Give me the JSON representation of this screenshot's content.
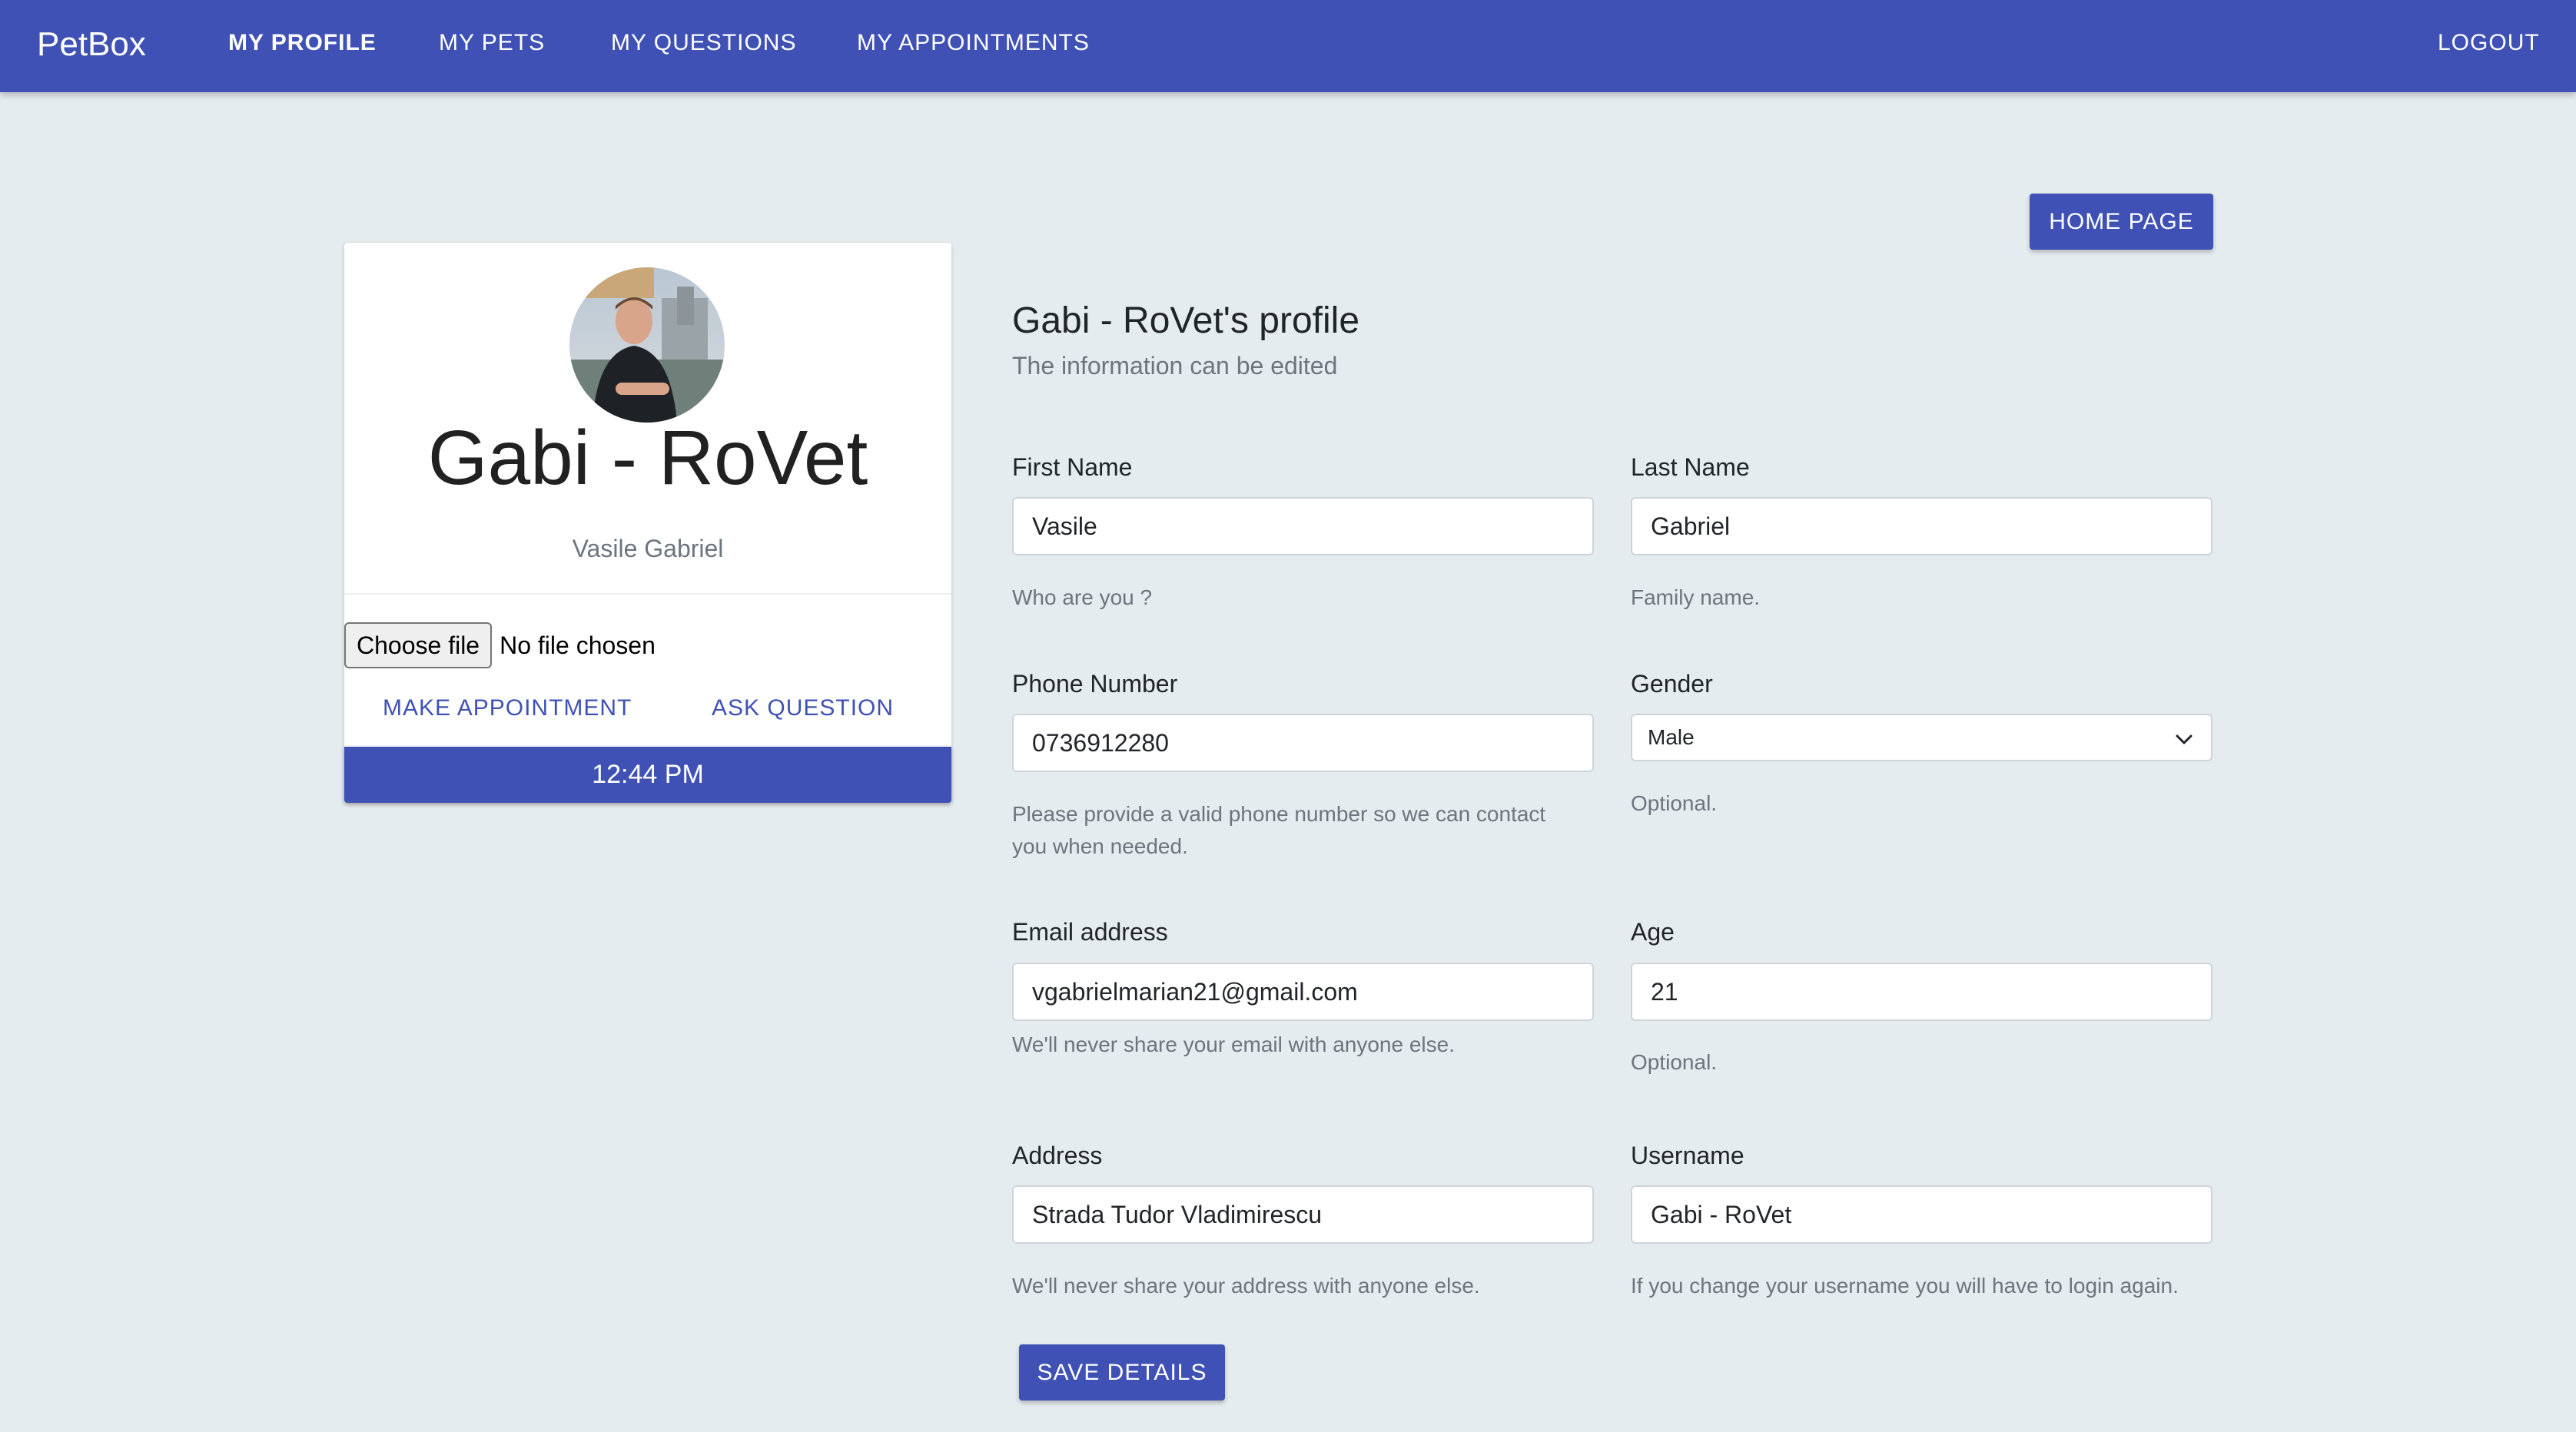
{
  "navbar": {
    "brand": "PetBox",
    "links": [
      "MY PROFILE",
      "MY PETS",
      "MY QUESTIONS",
      "MY APPOINTMENTS"
    ],
    "logout": "LOGOUT"
  },
  "card": {
    "name": "Gabi - RoVet",
    "full_name": "Vasile Gabriel",
    "file_button": "Choose file",
    "file_status": "No file chosen",
    "make_appointment": "MAKE APPOINTMENT",
    "ask_question": "ASK QUESTION",
    "time": "12:44 PM"
  },
  "home_button": "HOME PAGE",
  "profile": {
    "heading": "Gabi - RoVet's profile",
    "subheading": "The information can be edited"
  },
  "form": {
    "first_name": {
      "label": "First Name",
      "value": "Vasile",
      "help": "Who are you ?"
    },
    "last_name": {
      "label": "Last Name",
      "value": "Gabriel",
      "help": "Family name."
    },
    "phone": {
      "label": "Phone Number",
      "value": "0736912280",
      "help_line1": "Please provide a valid phone number so we can contact",
      "help_line2": "you when needed."
    },
    "gender": {
      "label": "Gender",
      "value": "Male",
      "help": "Optional."
    },
    "email": {
      "label": "Email address",
      "value": "vgabrielmarian21@gmail.com",
      "help": "We'll never share your email with anyone else."
    },
    "age": {
      "label": "Age",
      "value": "21",
      "help": "Optional."
    },
    "address": {
      "label": "Address",
      "value": "Strada Tudor Vladimirescu",
      "help": "We'll never share your address with anyone else."
    },
    "username": {
      "label": "Username",
      "value": "Gabi - RoVet",
      "help": "If you change your username you will have to login again."
    }
  },
  "save_button": "SAVE DETAILS",
  "colors": {
    "primary": "#3f51b5",
    "background": "#e5ecef",
    "muted": "#6c757d"
  }
}
